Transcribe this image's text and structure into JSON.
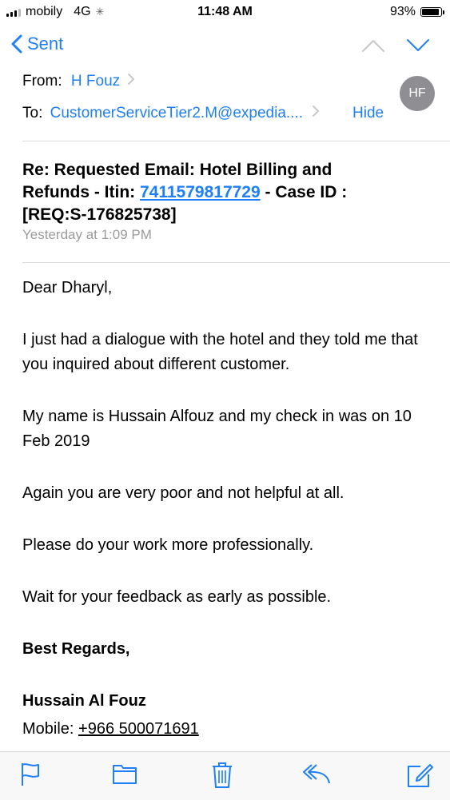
{
  "status_bar": {
    "carrier": "mobily",
    "network": "4G",
    "time": "11:48 AM",
    "battery_percent": "93%",
    "battery_level": 0.93
  },
  "nav": {
    "back_label": "Sent"
  },
  "header": {
    "from_label": "From:",
    "from_name": "H Fouz",
    "avatar_initials": "HF",
    "to_label": "To:",
    "to_address": "CustomerServiceTier2.M@expedia....",
    "hide_label": "Hide"
  },
  "subject": {
    "line1": "Re: Requested Email: Hotel Billing and",
    "line2_prefix": "Refunds - Itin: ",
    "itin_number": "7411579817729",
    "line2_suffix": " - Case ID :",
    "line3": "[REQ:S-176825738]"
  },
  "date": "Yesterday at 1:09 PM",
  "body": {
    "greeting": "Dear Dharyl,",
    "para1": "I just had a dialogue with the hotel and they told me that you inquired about different customer.",
    "para2": "My name is Hussain Alfouz and my check in was on 10 Feb 2019",
    "para3": "Again you are very poor and not helpful at all.",
    "para4": "Please do your work more professionally.",
    "para5": "Wait for your feedback as early as possible.",
    "closing": "Best Regards,",
    "signature_name": "Hussain Al Fouz",
    "mobile_label": "Mobile: ",
    "mobile_number": "+966 500071691"
  },
  "toolbar": {
    "icons": [
      "flag-icon",
      "folder-icon",
      "trash-icon",
      "reply-icon",
      "compose-icon"
    ]
  },
  "colors": {
    "accent": "#1f7ff7",
    "avatar": "#8e8e93",
    "secondary_text": "#9b9b9b"
  }
}
